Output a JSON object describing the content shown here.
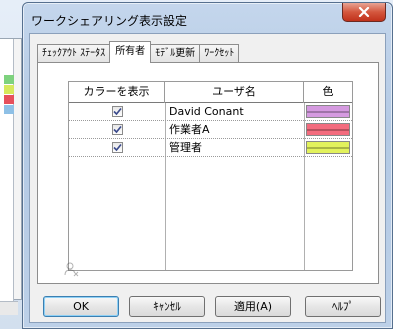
{
  "dialog": {
    "title": "ワークシェアリング表示設定",
    "close_label": "x"
  },
  "tabs": [
    {
      "label": "ﾁｪｯｸｱｳﾄ ｽﾃｰﾀｽ",
      "active": false
    },
    {
      "label": "所有者",
      "active": true
    },
    {
      "label": "ﾓﾃﾞﾙ更新",
      "active": false
    },
    {
      "label": "ﾜｰｸｾｯﾄ",
      "active": false
    }
  ],
  "table": {
    "headers": {
      "show_color": "カラーを表示",
      "user_name": "ユーザ名",
      "color": "色"
    },
    "rows": [
      {
        "checked": true,
        "user": "David Conant",
        "color": "#d59ae0",
        "stripe": "#b56fc4"
      },
      {
        "checked": true,
        "user": "作業者A",
        "color": "#f36c7e",
        "stripe": "#d94a5e"
      },
      {
        "checked": true,
        "user": "管理者",
        "color": "#e2f25c",
        "stripe": "#b9cc2a"
      }
    ]
  },
  "buttons": {
    "ok": "OK",
    "cancel": "ｷｬﾝｾﾙ",
    "apply": "適用(A)",
    "help": "ﾍﾙﾌﾟ"
  },
  "icons": {
    "close": "close-icon",
    "checkbox": "check-icon",
    "user": "user-icon"
  },
  "colors": {
    "accent": "#3c7fb1",
    "close_button": "#d4573e"
  }
}
